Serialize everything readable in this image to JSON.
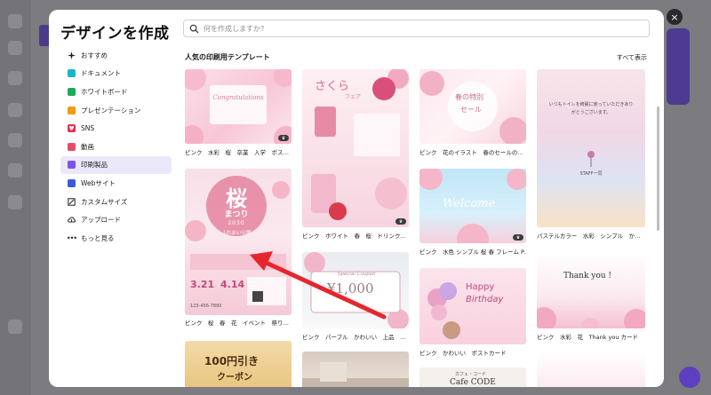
{
  "modal": {
    "title": "デザインを作成",
    "close_label": "×",
    "search_placeholder": "何を作成しますか？"
  },
  "sidebar": {
    "items": [
      {
        "label": "おすすめ",
        "icon": "sparkle-icon",
        "color": "#1c1c1e"
      },
      {
        "label": "ドキュメント",
        "icon": "document-icon",
        "color": "#19b6c9"
      },
      {
        "label": "ホワイトボード",
        "icon": "whiteboard-icon",
        "color": "#1fa85a"
      },
      {
        "label": "プレゼンテーション",
        "icon": "presentation-icon",
        "color": "#f29b17"
      },
      {
        "label": "SNS",
        "icon": "heart-icon",
        "color": "#e5304f"
      },
      {
        "label": "動画",
        "icon": "video-icon",
        "color": "#e84a6b"
      },
      {
        "label": "印刷製品",
        "icon": "print-icon",
        "color": "#7d52e8"
      },
      {
        "label": "Webサイト",
        "icon": "website-icon",
        "color": "#3b5bdb"
      },
      {
        "label": "カスタムサイズ",
        "icon": "resize-icon",
        "color": "#1c1c1e"
      },
      {
        "label": "アップロード",
        "icon": "cloud-upload-icon",
        "color": "#1c1c1e"
      },
      {
        "label": "もっと見る",
        "icon": "more-icon",
        "color": "#1c1c1e"
      }
    ],
    "active_index": 6
  },
  "section": {
    "title": "人気の印刷用テンプレート",
    "show_all": "すべて表示"
  },
  "cards": [
    {
      "caption": "ピンク　水彩　桜　卒業　入学　ポス…",
      "thumb_text": "Congratulations",
      "sub_text": ""
    },
    {
      "caption": "ピンク　ホワイト　春　桜　ドリンク…",
      "thumb_text": "さくら",
      "sub_text": "フェア"
    },
    {
      "caption": "ピンク　花のイラスト　春のセールの…",
      "thumb_text": "春の特別",
      "sub_text": "セール"
    },
    {
      "caption": "パステルカラー　水彩　シンプル　か…",
      "thumb_text": "いつもトイレを綺麗に使っていただきありがとうございます。",
      "sub_text": "STAFF一同"
    },
    {
      "caption": "ピンク　桜　春　花　イベント　祭り…",
      "thumb_text": "桜",
      "sub_text": "まつり",
      "year": "2030",
      "place": "ふれあい公園",
      "date1": "3.21",
      "date2": "4.14",
      "phone": "123-456-7890"
    },
    {
      "caption": "ピンク　水色 シンプル 桜 春 フレーム P…",
      "thumb_text": "Welcome",
      "sub_text": ""
    },
    {
      "caption": "ピンク　水彩　花　Thank you カード",
      "thumb_text": "Thank you !",
      "sub_text": ""
    },
    {
      "caption": "ピンク　パープル　かわいい　上品　…",
      "thumb_text": "¥1,000",
      "sub_text": "Special Coupon"
    },
    {
      "caption": "ピンク　かわいい　ポストカード",
      "thumb_text": "Happy",
      "sub_text": "Birthday"
    },
    {
      "caption": "",
      "thumb_text": "100円引き",
      "sub_text": "クーポン"
    },
    {
      "caption": "",
      "thumb_text": "",
      "sub_text": ""
    },
    {
      "caption": "",
      "thumb_text": "Cafe CODE",
      "sub_text": "カフェ・コード"
    },
    {
      "caption": "",
      "thumb_text": "",
      "sub_text": ""
    }
  ],
  "colors": {
    "accent": "#7d52e8",
    "active_bg": "#ece8fb",
    "arrow": "#e5262d",
    "overlay": "#7b7b80"
  }
}
